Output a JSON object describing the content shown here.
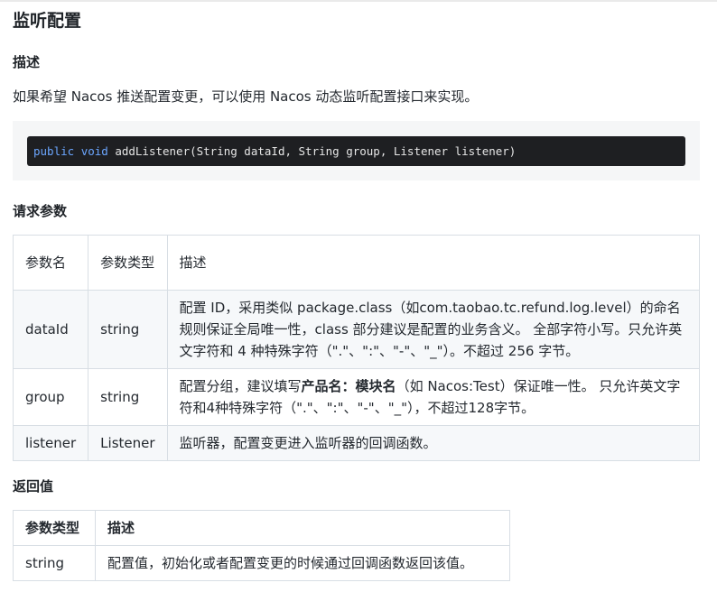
{
  "title": "监听配置",
  "desc_heading": "描述",
  "desc_text": "如果希望 Nacos 推送配置变更，可以使用 Nacos 动态监听配置接口来实现。",
  "code": {
    "kw1": "public",
    "kw2": "void",
    "rest": " addListener(String dataId, String group, Listener listener)"
  },
  "params_heading": "请求参数",
  "params_table": {
    "headers": [
      "参数名",
      "参数类型",
      "描述"
    ],
    "rows": [
      {
        "name": "dataId",
        "type": "string",
        "desc": "配置 ID，采用类似 package.class（如com.taobao.tc.refund.log.level）的命名规则保证全局唯一性，class 部分建议是配置的业务含义。 全部字符小写。只允许英文字符和 4 种特殊字符（\".\"、\":\"、\"-\"、\"_\"）。不超过 256 字节。"
      },
      {
        "name": "group",
        "type": "string",
        "desc_pre": "配置分组，建议填写",
        "desc_bold": "产品名：模块名",
        "desc_post": "（如 Nacos:Test）保证唯一性。 只允许英文字符和4种特殊字符（\".\"、\":\"、\"-\"、\"_\"），不超过128字节。"
      },
      {
        "name": "listener",
        "type": "Listener",
        "desc": "监听器，配置变更进入监听器的回调函数。"
      }
    ]
  },
  "return_heading": "返回值",
  "return_table": {
    "headers": [
      "参数类型",
      "描述"
    ],
    "rows": [
      {
        "type": "string",
        "desc": "配置值，初始化或者配置变更的时候通过回调函数返回该值。"
      }
    ]
  }
}
